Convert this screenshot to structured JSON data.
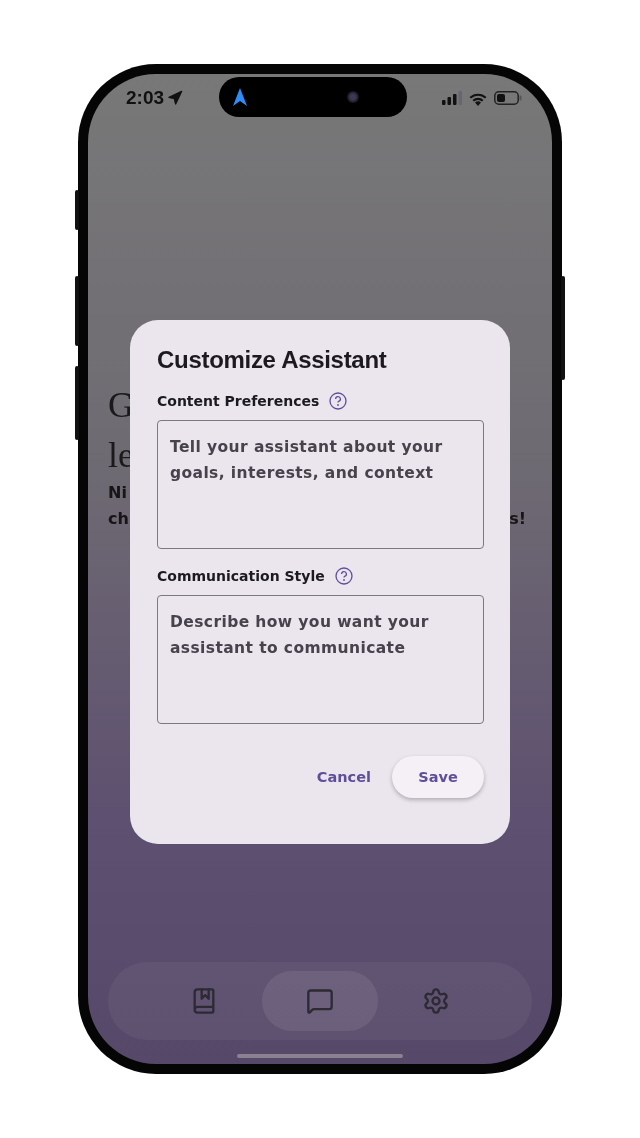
{
  "status_bar": {
    "time": "2:03"
  },
  "background": {
    "lines": [
      {
        "text": "G",
        "kind": "title"
      },
      {
        "text": "le",
        "kind": "title"
      },
      {
        "text": "Ni",
        "kind": "body"
      },
      {
        "text": "ch",
        "kind": "body"
      }
    ],
    "trailing": "s!"
  },
  "dialog": {
    "title": "Customize Assistant",
    "fields": [
      {
        "label": "Content Preferences",
        "placeholder": "Tell your assistant about your goals, interests, and context"
      },
      {
        "label": "Communication Style",
        "placeholder": "Describe how you want your assistant to communicate"
      }
    ],
    "buttons": [
      {
        "label": "Cancel",
        "kind": "text"
      },
      {
        "label": "Save",
        "kind": "filled"
      }
    ]
  },
  "nav": {
    "items": [
      {
        "selected": false
      },
      {
        "selected": true
      },
      {
        "selected": false
      }
    ]
  }
}
